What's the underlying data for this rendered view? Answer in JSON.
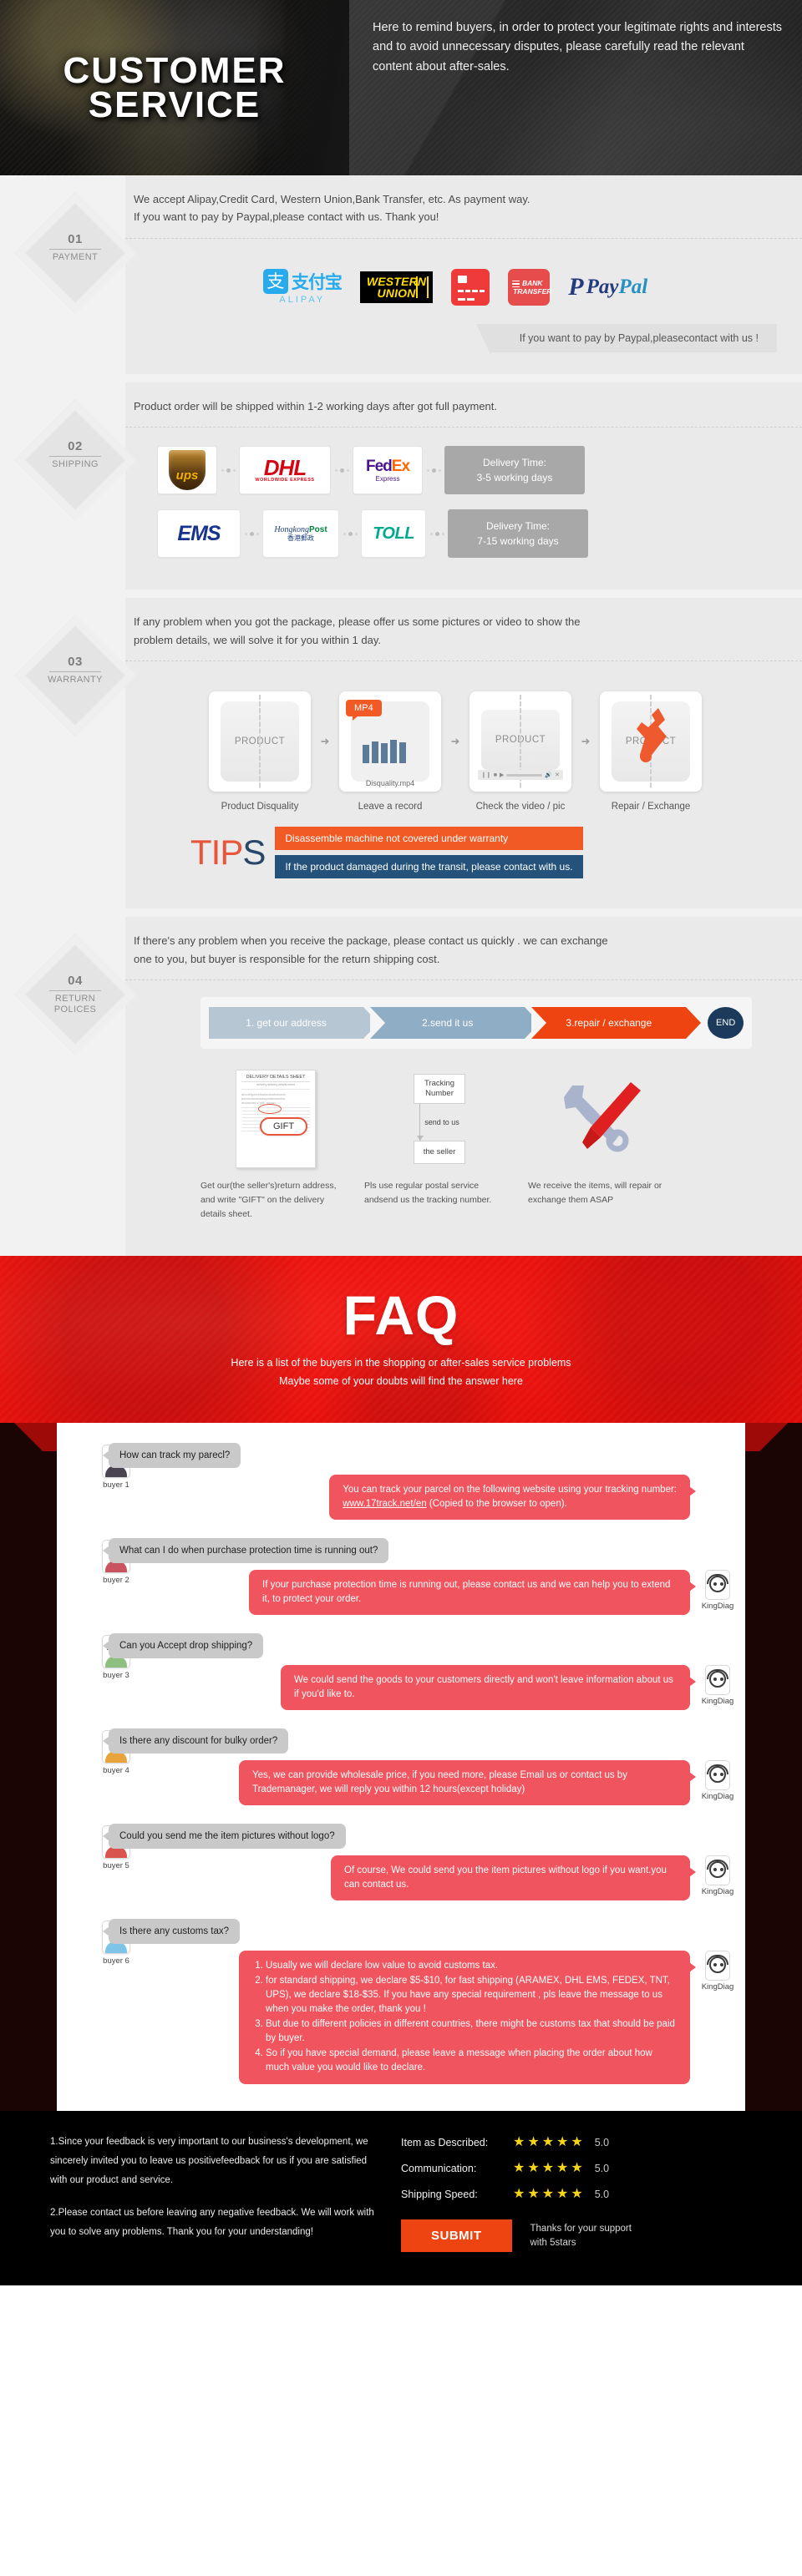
{
  "hero": {
    "title_line1": "CUSTOMER",
    "title_line2": "SERVICE",
    "description": "Here to remind buyers, in order to protect your legitimate rights and interests and to avoid unnecessary disputes, please carefully read the relevant content about after-sales."
  },
  "payment": {
    "number": "01",
    "label": "PAYMENT",
    "headline_line1": "We accept Alipay,Credit Card, Western Union,Bank Transfer, etc. As payment way.",
    "headline_line2": "If you want to pay by Paypal,please contact with us. Thank you!",
    "logos": [
      {
        "name": "alipay",
        "cn": "支付宝",
        "en": "ALIPAY"
      },
      {
        "name": "western-union",
        "line1": "WESTERN",
        "line2": "UNION"
      },
      {
        "name": "credit-card"
      },
      {
        "name": "bank-transfer",
        "line1": "BANK",
        "line2": "TRANSFER"
      },
      {
        "name": "paypal",
        "word1": "Pay",
        "word2": "Pal"
      }
    ],
    "note": "If you want to pay by Paypal,pleasecontact with us !"
  },
  "shipping": {
    "number": "02",
    "label": "SHIPPING",
    "headline": "Product order will be shipped within 1-2 working days after got full payment.",
    "row1": {
      "carriers": [
        "ups",
        "dhl",
        "fedex"
      ],
      "dhl_sub": "WORLDWIDE EXPRESS",
      "fedex_a": "Fed",
      "fedex_b": "Ex",
      "fedex_c": "Express",
      "delivery_label": "Delivery Time:",
      "delivery_value": "3-5 working days"
    },
    "row2": {
      "carriers": [
        "ems",
        "hongkong-post",
        "toll"
      ],
      "hk_en1": "Hongkong",
      "hk_en2": "Post",
      "hk_cn": "香港郵政",
      "toll": "TOLL",
      "delivery_label": "Delivery Time:",
      "delivery_value": "7-15 working days"
    }
  },
  "warranty": {
    "number": "03",
    "label": "WARRANTY",
    "headline_line1": "If any problem when you got the package, please offer us some pictures or video to show the",
    "headline_line2": "problem details, we will solve it for you within 1 day.",
    "steps": [
      {
        "caption": "Product Disquality",
        "product_label": "PRODUCT"
      },
      {
        "caption": "Leave a record",
        "tag": "MP4",
        "filename": "Disquality.mp4"
      },
      {
        "caption": "Check the video / pic",
        "product_label": "PRODUCT"
      },
      {
        "caption": "Repair / Exchange",
        "product_label": "PRODUCT"
      }
    ],
    "tips_word_part1": "TIP",
    "tips_word_part2": "S",
    "tip_orange": "Disassemble machine not covered under warranty",
    "tip_blue": "If the product damaged during the transit, please contact with us."
  },
  "returns": {
    "number": "04",
    "label": "RETURN\nPOLICES",
    "headline_line1": "If there's any problem when you receive the package, please contact us quickly . we can exchange",
    "headline_line2": "one to you, but buyer is responsible for the return shipping cost.",
    "flow": [
      "1. get our address",
      "2.send it us",
      "3.repair / exchange"
    ],
    "end": "END",
    "cols": [
      {
        "sheet_title": "DELIVERY DETAILS SHEET",
        "sheet_sub": "delivery        delivery details sheet",
        "sheet_text1": "abcdefgasddsadsdsadsdsads",
        "sheet_text2": "asdasdasdaadagadasdsadsa",
        "sheet_text3": "asdasdad s\"gift\" adsad",
        "gift": "GIFT",
        "caption": "Get our(the seller's)return address, and write \"GIFT\" on the delivery details sheet."
      },
      {
        "box_top": "Tracking Number",
        "arrow_label": "send to us",
        "box_bottom": "the seller",
        "caption": "Pls use regular postal service andsend us the tracking number."
      },
      {
        "caption": "We receive the items, will repair or exchange them ASAP"
      }
    ]
  },
  "faq": {
    "title": "FAQ",
    "sub_line1": "Here is a list of the buyers in the shopping or after-sales service problems",
    "sub_line2": "Maybe some of your doubts will find the answer here",
    "operator_name": "KingDiag",
    "items": [
      {
        "buyer": "buyer 1",
        "question": "How can track my parecl?",
        "answer_pre": "You can track your parcel on the following website using your tracking number:",
        "answer_link": "www.17track.net/en",
        "answer_post": "(Copied to the browser to open).",
        "show_operator": false
      },
      {
        "buyer": "buyer 2",
        "question": "What can I do when purchase protection time is running out?",
        "answer": "If your purchase protection time is running out, please contact us and we can help you to extend it, to protect your order.",
        "show_operator": true
      },
      {
        "buyer": "buyer 3",
        "question": "Can you Accept drop shipping?",
        "answer": "We could send the goods to your customers directly and won't leave information about us if you'd like to.",
        "show_operator": true
      },
      {
        "buyer": "buyer 4",
        "question": "Is there any discount for bulky order?",
        "answer": "Yes, we can provide wholesale price, if you need more, please Email us or contact us by Trademanager, we will reply you within 12 hours(except holiday)",
        "show_operator": true
      },
      {
        "buyer": "buyer 5",
        "question": "Could you send me the item pictures without logo?",
        "answer": "Of course, We could send you the item pictures without logo if you want.you can contact us.",
        "show_operator": true
      },
      {
        "buyer": "buyer 6",
        "question": "Is there any customs tax?",
        "answer_list": [
          "Usually we will declare low value to avoid customs tax.",
          "for standard shipping, we declare $5-$10, for fast shipping (ARAMEX, DHL EMS, FEDEX, TNT, UPS), we declare $18-$35. If you have any special requirement , pls leave the message to us when you make the order, thank you !",
          "But due to different policies in different countries, there might be customs tax that should be paid by buyer.",
          "So if you have special demand, please leave a message when placing the order about how much value you would like to declare."
        ],
        "show_operator": true
      }
    ]
  },
  "footer": {
    "para1": "1.Since your feedback is very important to our business's development, we sincerely invited you to leave us positivefeedback for us if you are satisfied with our product and service.",
    "para2": "2.Please contact us before leaving any negative feedback. We will work with you to solve any problems. Thank you for your understanding!",
    "ratings": [
      {
        "label": "Item as Described:",
        "stars": 5,
        "value": "5.0"
      },
      {
        "label": "Communication:",
        "stars": 5,
        "value": "5.0"
      },
      {
        "label": "Shipping Speed:",
        "stars": 5,
        "value": "5.0"
      }
    ],
    "submit_label": "SUBMIT",
    "thanks_line1": "Thanks for your support",
    "thanks_line2": "with 5stars"
  },
  "colors": {
    "brand_red": "#EE4411",
    "faq_red": "#EC1410",
    "bubble_red": "#F0545F",
    "tip_blue": "#24527A",
    "star_yellow": "#F5D616"
  }
}
